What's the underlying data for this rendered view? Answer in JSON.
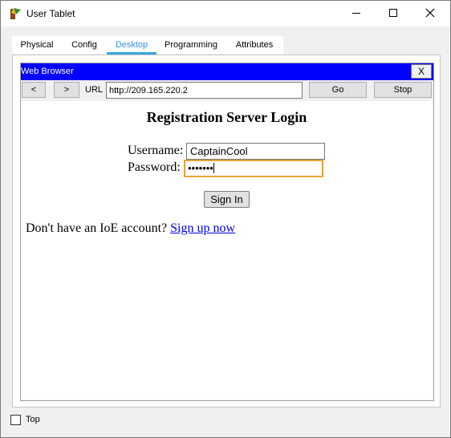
{
  "window": {
    "title": "User Tablet",
    "icon": "packet-tracer-device-icon"
  },
  "tabs": [
    {
      "label": "Physical",
      "active": false
    },
    {
      "label": "Config",
      "active": false
    },
    {
      "label": "Desktop",
      "active": true
    },
    {
      "label": "Programming",
      "active": false
    },
    {
      "label": "Attributes",
      "active": false
    }
  ],
  "browser": {
    "title": "Web Browser",
    "close_label": "X",
    "back_label": "<",
    "forward_label": ">",
    "url_label": "URL",
    "url_value": "http://209.165.220.2",
    "go_label": "Go",
    "stop_label": "Stop"
  },
  "page": {
    "heading": "Registration Server Login",
    "username_label": "Username:",
    "username_value": "CaptainCool",
    "password_label": "Password:",
    "password_masked": "•••••••",
    "signin_label": "Sign In",
    "signup_prompt": "Don't have an IoE account? ",
    "signup_link": "Sign up now"
  },
  "footer": {
    "top_label": "Top",
    "top_checked": false
  },
  "colors": {
    "browser_header": "#0000ff",
    "active_tab": "#3a8fd9",
    "focus_border": "#e8a33c",
    "link": "#0000ee"
  }
}
